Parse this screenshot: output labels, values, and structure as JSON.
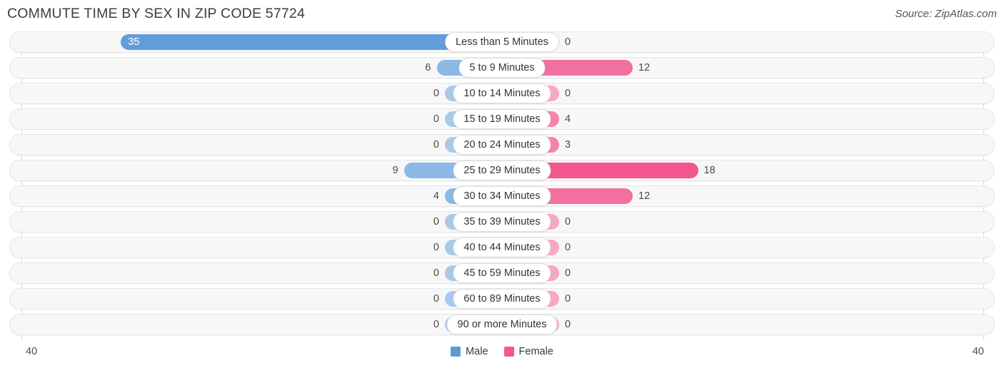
{
  "header": {
    "title": "COMMUTE TIME BY SEX IN ZIP CODE 57724",
    "source": "Source: ZipAtlas.com"
  },
  "legend": {
    "male_label": "Male",
    "female_label": "Female",
    "male_color": "#5b9bd5",
    "female_color": "#f4578f"
  },
  "axis": {
    "left_tick": "40",
    "right_tick": "40",
    "max": 40
  },
  "colors": {
    "male_strong": "#629ddb",
    "male_light": "#a9c9ec",
    "female_strong": "#f4578f",
    "female_mid": "#f2709f",
    "female_light": "#f8a8c2",
    "track_bg": "#f7f7f7",
    "track_border": "#e6e6e6"
  },
  "chart_data": {
    "type": "bar",
    "title": "COMMUTE TIME BY SEX IN ZIP CODE 57724",
    "subtitle": "",
    "xlabel": "",
    "ylabel": "",
    "orientation": "horizontal-diverging",
    "axis_max": 40,
    "xlim": [
      -40,
      40
    ],
    "grid": false,
    "legend_position": "bottom-center",
    "categories": [
      "Less than 5 Minutes",
      "5 to 9 Minutes",
      "10 to 14 Minutes",
      "15 to 19 Minutes",
      "20 to 24 Minutes",
      "25 to 29 Minutes",
      "30 to 34 Minutes",
      "35 to 39 Minutes",
      "40 to 44 Minutes",
      "45 to 59 Minutes",
      "60 to 89 Minutes",
      "90 or more Minutes"
    ],
    "series": [
      {
        "name": "Male",
        "color": "#5b9bd5",
        "values": [
          35,
          6,
          0,
          0,
          0,
          9,
          4,
          0,
          0,
          0,
          0,
          0
        ]
      },
      {
        "name": "Female",
        "color": "#f4578f",
        "values": [
          0,
          12,
          0,
          4,
          3,
          18,
          12,
          0,
          0,
          0,
          0,
          0
        ]
      }
    ]
  },
  "rows": [
    {
      "label": "Less than 5 Minutes",
      "male": 35,
      "female": 0,
      "male_text": "35",
      "female_text": "0"
    },
    {
      "label": "5 to 9 Minutes",
      "male": 6,
      "female": 12,
      "male_text": "6",
      "female_text": "12"
    },
    {
      "label": "10 to 14 Minutes",
      "male": 0,
      "female": 0,
      "male_text": "0",
      "female_text": "0"
    },
    {
      "label": "15 to 19 Minutes",
      "male": 0,
      "female": 4,
      "male_text": "0",
      "female_text": "4"
    },
    {
      "label": "20 to 24 Minutes",
      "male": 0,
      "female": 3,
      "male_text": "0",
      "female_text": "3"
    },
    {
      "label": "25 to 29 Minutes",
      "male": 9,
      "female": 18,
      "male_text": "9",
      "female_text": "18"
    },
    {
      "label": "30 to 34 Minutes",
      "male": 4,
      "female": 12,
      "male_text": "4",
      "female_text": "12"
    },
    {
      "label": "35 to 39 Minutes",
      "male": 0,
      "female": 0,
      "male_text": "0",
      "female_text": "0"
    },
    {
      "label": "40 to 44 Minutes",
      "male": 0,
      "female": 0,
      "male_text": "0",
      "female_text": "0"
    },
    {
      "label": "45 to 59 Minutes",
      "male": 0,
      "female": 0,
      "male_text": "0",
      "female_text": "0"
    },
    {
      "label": "60 to 89 Minutes",
      "male": 0,
      "female": 0,
      "male_text": "0",
      "female_text": "0"
    },
    {
      "label": "90 or more Minutes",
      "male": 0,
      "female": 0,
      "male_text": "0",
      "female_text": "0"
    }
  ]
}
